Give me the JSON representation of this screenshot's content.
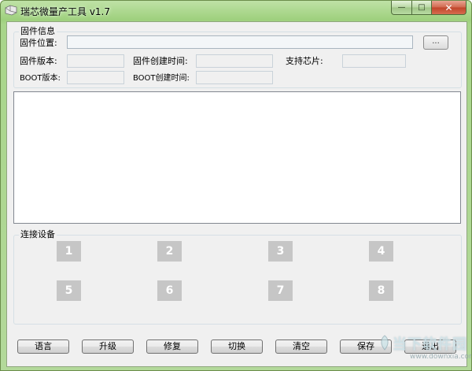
{
  "window": {
    "title": "瑞芯微量产工具 v1.7",
    "buttons": {
      "minimize": "—",
      "maximize": "□",
      "close": "✕"
    }
  },
  "firmware_info": {
    "group_title": "固件信息",
    "location_label": "固件位置:",
    "location_value": "",
    "browse_label": "...",
    "version_label": "固件版本:",
    "version_value": "",
    "created_label": "固件创建时间:",
    "created_value": "",
    "chip_label": "支持芯片:",
    "chip_value": "",
    "boot_version_label": "BOOT版本:",
    "boot_version_value": "",
    "boot_created_label": "BOOT创建时间:",
    "boot_created_value": ""
  },
  "log": {
    "content": ""
  },
  "devices": {
    "group_title": "连接设备",
    "slots": [
      "1",
      "2",
      "3",
      "4",
      "5",
      "6",
      "7",
      "8"
    ]
  },
  "actions": {
    "language": "语言",
    "upgrade": "升级",
    "repair": "修复",
    "switch": "切换",
    "clear": "清空",
    "save": "保存",
    "exit": "退出"
  },
  "watermark": {
    "main": "当下软件园",
    "sub": "www.downxia.com"
  },
  "colors": {
    "titlebar": "#a8d58a",
    "client": "#f0f0f0",
    "device_slot": "#c6c6c6",
    "close_button": "#c0442a"
  }
}
